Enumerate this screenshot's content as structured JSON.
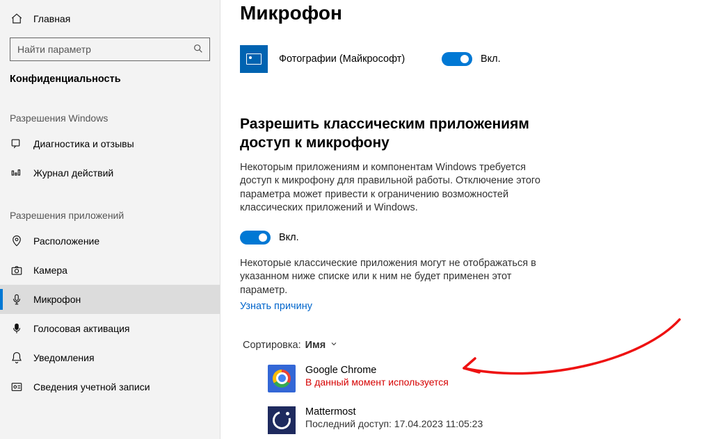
{
  "sidebar": {
    "home": "Главная",
    "search_placeholder": "Найти параметр",
    "category": "Конфиденциальность",
    "section_windows": "Разрешения Windows",
    "section_apps": "Разрешения приложений",
    "items_windows": [
      {
        "label": "Диагностика и отзывы",
        "icon": "feedback-icon"
      },
      {
        "label": "Журнал действий",
        "icon": "activity-icon"
      }
    ],
    "items_apps": [
      {
        "label": "Расположение",
        "icon": "location-icon"
      },
      {
        "label": "Камера",
        "icon": "camera-icon"
      },
      {
        "label": "Микрофон",
        "icon": "microphone-icon",
        "selected": true
      },
      {
        "label": "Голосовая активация",
        "icon": "voice-icon"
      },
      {
        "label": "Уведомления",
        "icon": "notifications-icon"
      },
      {
        "label": "Сведения учетной записи",
        "icon": "account-icon"
      }
    ]
  },
  "main": {
    "title": "Микрофон",
    "top_app": {
      "name": "Фотографии (Майкрософт)",
      "toggle_label": "Вкл."
    },
    "section_heading": "Разрешить классическим приложениям доступ к микрофону",
    "section_body": "Некоторым приложениям и компонентам Windows требуется доступ к микрофону для правильной работы. Отключение этого параметра может привести к ограничению возможностей классических приложений и Windows.",
    "desktop_toggle_label": "Вкл.",
    "desktop_note": "Некоторые классические приложения могут не отображаться в указанном ниже списке или к ним не будет применен этот параметр.",
    "learn_link": "Узнать причину",
    "sort_prefix": "Сортировка:",
    "sort_value": "Имя",
    "desktop_apps": [
      {
        "name": "Google Chrome",
        "status": "В данный момент используется",
        "active": true,
        "icon": "chrome"
      },
      {
        "name": "Mattermost",
        "status": "Последний доступ: 17.04.2023 11:05:23",
        "active": false,
        "icon": "mm"
      }
    ]
  }
}
